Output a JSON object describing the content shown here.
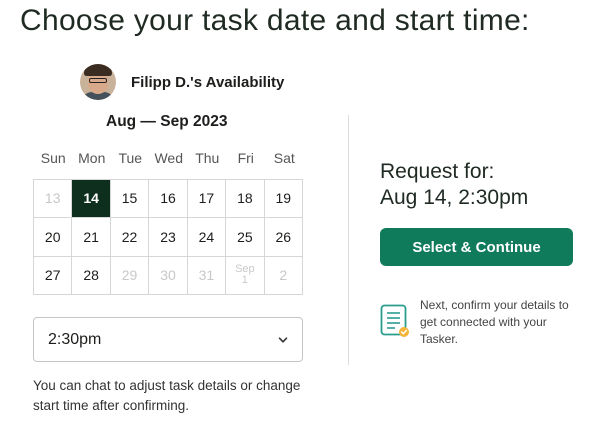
{
  "page": {
    "title": "Choose your task date and start time:"
  },
  "tasker": {
    "availability_label": "Filipp D.'s Availability",
    "avatar_icon": "person-avatar"
  },
  "calendar": {
    "month_label": "Aug — Sep 2023",
    "weekdays": [
      "Sun",
      "Mon",
      "Tue",
      "Wed",
      "Thu",
      "Fri",
      "Sat"
    ],
    "days": [
      {
        "label": "13",
        "state": "disabled"
      },
      {
        "label": "14",
        "state": "selected"
      },
      {
        "label": "15",
        "state": "available"
      },
      {
        "label": "16",
        "state": "available"
      },
      {
        "label": "17",
        "state": "available"
      },
      {
        "label": "18",
        "state": "available"
      },
      {
        "label": "19",
        "state": "available"
      },
      {
        "label": "20",
        "state": "available"
      },
      {
        "label": "21",
        "state": "available"
      },
      {
        "label": "22",
        "state": "available"
      },
      {
        "label": "23",
        "state": "available"
      },
      {
        "label": "24",
        "state": "available"
      },
      {
        "label": "25",
        "state": "available"
      },
      {
        "label": "26",
        "state": "available"
      },
      {
        "label": "27",
        "state": "available"
      },
      {
        "label": "28",
        "state": "available"
      },
      {
        "label": "29",
        "state": "disabled"
      },
      {
        "label": "30",
        "state": "disabled"
      },
      {
        "label": "31",
        "state": "disabled"
      },
      {
        "label": "Sep",
        "sub": "1",
        "state": "disabled"
      },
      {
        "label": "2",
        "state": "disabled"
      }
    ]
  },
  "time_select": {
    "value": "2:30pm",
    "icon": "chevron-down-icon"
  },
  "helper_text": "You can chat to adjust task details or change start time after confirming.",
  "request": {
    "label": "Request for:",
    "value": "Aug 14, 2:30pm"
  },
  "cta": {
    "label": "Select & Continue"
  },
  "next_step": {
    "text": "Next, confirm your details to get connected with your Tasker.",
    "icon": "checklist-icon"
  },
  "colors": {
    "primary": "#0f7b5b",
    "selected_day": "#0e2e1e",
    "icon_teal": "#2a9d8f",
    "icon_badge": "#f2b53a"
  }
}
